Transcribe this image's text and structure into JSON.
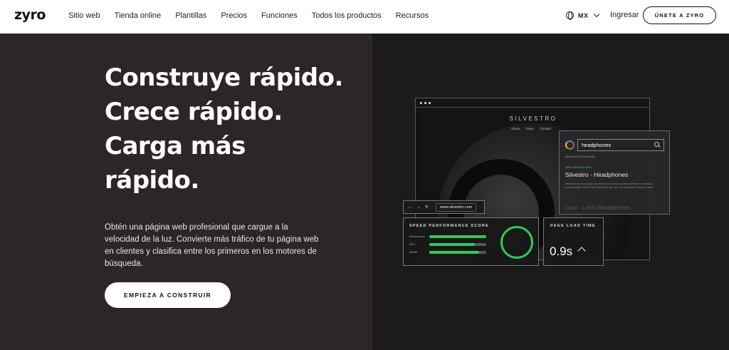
{
  "nav": {
    "logo": "zyro",
    "links": [
      "Sitio web",
      "Tienda online",
      "Plantillas",
      "Precios",
      "Funciones",
      "Todos los productos",
      "Recursos"
    ],
    "lang": "MX",
    "login": "Ingresar",
    "join": "ÚNETE A ZYRO"
  },
  "hero": {
    "headline": "Construye rápido. Crece rápido. Carga más rápido.",
    "sub": "Obtén una página web profesional que cargue a la velocidad de la luz. Convierte más tráfico de tu página web en clientes y clasifica entre los primeros en los motores de búsqueda.",
    "cta": "EMPIEZA A CONSTRUIR"
  },
  "mock": {
    "brand": "SILVESTRO",
    "site_nav": [
      "About",
      "Store",
      "Contact"
    ],
    "serp": {
      "query": "headphones",
      "about": "About 67,000,000 results",
      "url": "www.silvestro.com",
      "title": "Silvestro -  Headphones",
      "desc": "Headphones let a single user listen to an audio source privately, in contrast to a loudspeaker, which emits sound into the open air for anyone nearby to hear.",
      "faded": "Lool - Lolol Headphones"
    },
    "urlbar": "www.silvestro.com",
    "speed": {
      "title": "SPEED PERFORMANCE SCORE",
      "metrics": [
        {
          "label": "Performance",
          "value": 1.0
        },
        {
          "label": "SEO",
          "value": 0.8
        },
        {
          "label": "Mobile",
          "value": 0.88
        }
      ],
      "score_color": "#35c759"
    },
    "load": {
      "title": "PAGE LOAD TIME",
      "value": "0.9s"
    }
  }
}
